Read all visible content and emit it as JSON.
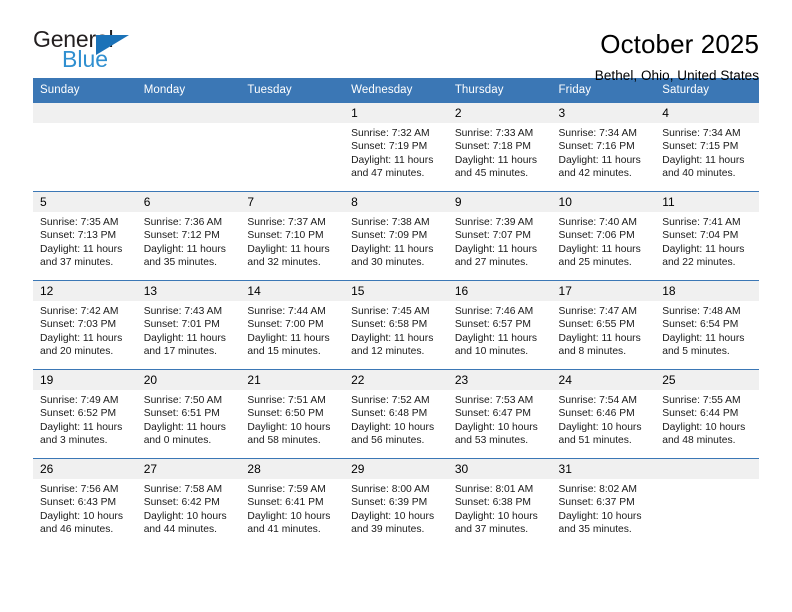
{
  "brand": {
    "name_top": "General",
    "name_bottom": "Blue",
    "triangle_color": "#1b72b8",
    "blue_text_color": "#2f8fd0"
  },
  "header": {
    "title": "October 2025",
    "subtitle": "Bethel, Ohio, United States",
    "header_bg": "#3b77b5",
    "header_text": "#ffffff",
    "daynum_bg": "#f0f0f0"
  },
  "weekday_headers": [
    "Sunday",
    "Monday",
    "Tuesday",
    "Wednesday",
    "Thursday",
    "Friday",
    "Saturday"
  ],
  "labels": {
    "sunrise": "Sunrise:",
    "sunset": "Sunset:",
    "daylight": "Daylight:"
  },
  "weeks": [
    [
      {
        "day": "",
        "lines": []
      },
      {
        "day": "",
        "lines": []
      },
      {
        "day": "",
        "lines": []
      },
      {
        "day": "1",
        "lines": [
          "Sunrise: 7:32 AM",
          "Sunset: 7:19 PM",
          "Daylight: 11 hours",
          "and 47 minutes."
        ]
      },
      {
        "day": "2",
        "lines": [
          "Sunrise: 7:33 AM",
          "Sunset: 7:18 PM",
          "Daylight: 11 hours",
          "and 45 minutes."
        ]
      },
      {
        "day": "3",
        "lines": [
          "Sunrise: 7:34 AM",
          "Sunset: 7:16 PM",
          "Daylight: 11 hours",
          "and 42 minutes."
        ]
      },
      {
        "day": "4",
        "lines": [
          "Sunrise: 7:34 AM",
          "Sunset: 7:15 PM",
          "Daylight: 11 hours",
          "and 40 minutes."
        ]
      }
    ],
    [
      {
        "day": "5",
        "lines": [
          "Sunrise: 7:35 AM",
          "Sunset: 7:13 PM",
          "Daylight: 11 hours",
          "and 37 minutes."
        ]
      },
      {
        "day": "6",
        "lines": [
          "Sunrise: 7:36 AM",
          "Sunset: 7:12 PM",
          "Daylight: 11 hours",
          "and 35 minutes."
        ]
      },
      {
        "day": "7",
        "lines": [
          "Sunrise: 7:37 AM",
          "Sunset: 7:10 PM",
          "Daylight: 11 hours",
          "and 32 minutes."
        ]
      },
      {
        "day": "8",
        "lines": [
          "Sunrise: 7:38 AM",
          "Sunset: 7:09 PM",
          "Daylight: 11 hours",
          "and 30 minutes."
        ]
      },
      {
        "day": "9",
        "lines": [
          "Sunrise: 7:39 AM",
          "Sunset: 7:07 PM",
          "Daylight: 11 hours",
          "and 27 minutes."
        ]
      },
      {
        "day": "10",
        "lines": [
          "Sunrise: 7:40 AM",
          "Sunset: 7:06 PM",
          "Daylight: 11 hours",
          "and 25 minutes."
        ]
      },
      {
        "day": "11",
        "lines": [
          "Sunrise: 7:41 AM",
          "Sunset: 7:04 PM",
          "Daylight: 11 hours",
          "and 22 minutes."
        ]
      }
    ],
    [
      {
        "day": "12",
        "lines": [
          "Sunrise: 7:42 AM",
          "Sunset: 7:03 PM",
          "Daylight: 11 hours",
          "and 20 minutes."
        ]
      },
      {
        "day": "13",
        "lines": [
          "Sunrise: 7:43 AM",
          "Sunset: 7:01 PM",
          "Daylight: 11 hours",
          "and 17 minutes."
        ]
      },
      {
        "day": "14",
        "lines": [
          "Sunrise: 7:44 AM",
          "Sunset: 7:00 PM",
          "Daylight: 11 hours",
          "and 15 minutes."
        ]
      },
      {
        "day": "15",
        "lines": [
          "Sunrise: 7:45 AM",
          "Sunset: 6:58 PM",
          "Daylight: 11 hours",
          "and 12 minutes."
        ]
      },
      {
        "day": "16",
        "lines": [
          "Sunrise: 7:46 AM",
          "Sunset: 6:57 PM",
          "Daylight: 11 hours",
          "and 10 minutes."
        ]
      },
      {
        "day": "17",
        "lines": [
          "Sunrise: 7:47 AM",
          "Sunset: 6:55 PM",
          "Daylight: 11 hours",
          "and 8 minutes."
        ]
      },
      {
        "day": "18",
        "lines": [
          "Sunrise: 7:48 AM",
          "Sunset: 6:54 PM",
          "Daylight: 11 hours",
          "and 5 minutes."
        ]
      }
    ],
    [
      {
        "day": "19",
        "lines": [
          "Sunrise: 7:49 AM",
          "Sunset: 6:52 PM",
          "Daylight: 11 hours",
          "and 3 minutes."
        ]
      },
      {
        "day": "20",
        "lines": [
          "Sunrise: 7:50 AM",
          "Sunset: 6:51 PM",
          "Daylight: 11 hours",
          "and 0 minutes."
        ]
      },
      {
        "day": "21",
        "lines": [
          "Sunrise: 7:51 AM",
          "Sunset: 6:50 PM",
          "Daylight: 10 hours",
          "and 58 minutes."
        ]
      },
      {
        "day": "22",
        "lines": [
          "Sunrise: 7:52 AM",
          "Sunset: 6:48 PM",
          "Daylight: 10 hours",
          "and 56 minutes."
        ]
      },
      {
        "day": "23",
        "lines": [
          "Sunrise: 7:53 AM",
          "Sunset: 6:47 PM",
          "Daylight: 10 hours",
          "and 53 minutes."
        ]
      },
      {
        "day": "24",
        "lines": [
          "Sunrise: 7:54 AM",
          "Sunset: 6:46 PM",
          "Daylight: 10 hours",
          "and 51 minutes."
        ]
      },
      {
        "day": "25",
        "lines": [
          "Sunrise: 7:55 AM",
          "Sunset: 6:44 PM",
          "Daylight: 10 hours",
          "and 48 minutes."
        ]
      }
    ],
    [
      {
        "day": "26",
        "lines": [
          "Sunrise: 7:56 AM",
          "Sunset: 6:43 PM",
          "Daylight: 10 hours",
          "and 46 minutes."
        ]
      },
      {
        "day": "27",
        "lines": [
          "Sunrise: 7:58 AM",
          "Sunset: 6:42 PM",
          "Daylight: 10 hours",
          "and 44 minutes."
        ]
      },
      {
        "day": "28",
        "lines": [
          "Sunrise: 7:59 AM",
          "Sunset: 6:41 PM",
          "Daylight: 10 hours",
          "and 41 minutes."
        ]
      },
      {
        "day": "29",
        "lines": [
          "Sunrise: 8:00 AM",
          "Sunset: 6:39 PM",
          "Daylight: 10 hours",
          "and 39 minutes."
        ]
      },
      {
        "day": "30",
        "lines": [
          "Sunrise: 8:01 AM",
          "Sunset: 6:38 PM",
          "Daylight: 10 hours",
          "and 37 minutes."
        ]
      },
      {
        "day": "31",
        "lines": [
          "Sunrise: 8:02 AM",
          "Sunset: 6:37 PM",
          "Daylight: 10 hours",
          "and 35 minutes."
        ]
      },
      {
        "day": "",
        "lines": []
      }
    ]
  ]
}
